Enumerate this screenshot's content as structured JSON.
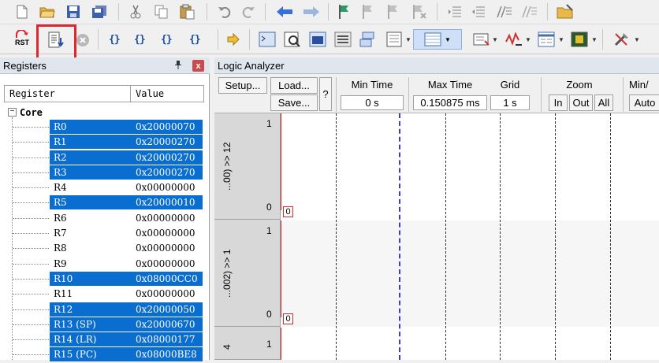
{
  "registers_panel": {
    "title": "Registers",
    "pin_glyph": "យ",
    "close_glyph": "x",
    "col_register": "Register",
    "col_value": "Value",
    "group": "Core",
    "group_expander": "−",
    "rows": [
      {
        "name": "R0",
        "value": "0x20000070",
        "selected": true
      },
      {
        "name": "R1",
        "value": "0x20000270",
        "selected": true
      },
      {
        "name": "R2",
        "value": "0x20000270",
        "selected": true
      },
      {
        "name": "R3",
        "value": "0x20000270",
        "selected": true
      },
      {
        "name": "R4",
        "value": "0x00000000",
        "selected": false
      },
      {
        "name": "R5",
        "value": "0x20000010",
        "selected": true
      },
      {
        "name": "R6",
        "value": "0x00000000",
        "selected": false
      },
      {
        "name": "R7",
        "value": "0x00000000",
        "selected": false
      },
      {
        "name": "R8",
        "value": "0x00000000",
        "selected": false
      },
      {
        "name": "R9",
        "value": "0x00000000",
        "selected": false
      },
      {
        "name": "R10",
        "value": "0x08000CC0",
        "selected": true
      },
      {
        "name": "R11",
        "value": "0x00000000",
        "selected": false
      },
      {
        "name": "R12",
        "value": "0x20000050",
        "selected": true
      },
      {
        "name": "R13 (SP)",
        "value": "0x20000670",
        "selected": true
      },
      {
        "name": "R14 (LR)",
        "value": "0x08000177",
        "selected": true
      },
      {
        "name": "R15 (PC)",
        "value": "0x08000BE8",
        "selected": true
      }
    ]
  },
  "logic_analyzer": {
    "title": "Logic Analyzer",
    "setup_label": "Setup...",
    "load_label": "Load...",
    "save_label": "Save...",
    "help_label": "?",
    "min_time_label": "Min Time",
    "min_time_value": "0 s",
    "max_time_label": "Max Time",
    "max_time_value": "0.150875 ms",
    "grid_label": "Grid",
    "grid_value": "1 s",
    "zoom_label": "Zoom",
    "zoom_in": "In",
    "zoom_out": "Out",
    "zoom_all": "All",
    "minmax_label": "Min/",
    "auto_label": "Auto",
    "signals": [
      {
        "name": "...00) >> 12",
        "max": "1",
        "min": "0",
        "value": "0"
      },
      {
        "name": "...002) >> 1",
        "max": "1",
        "min": "0",
        "value": "0"
      },
      {
        "name": "4",
        "max": "1",
        "min": "",
        "value": ""
      }
    ]
  },
  "toolbar": {
    "rst_label": "RST",
    "braces": [
      "{}",
      "{}",
      "{}",
      "{}"
    ]
  },
  "colors": {
    "selection": "#0a6ed1",
    "highlight_box": "#e0262e",
    "cursor": "#3a3ad8"
  }
}
